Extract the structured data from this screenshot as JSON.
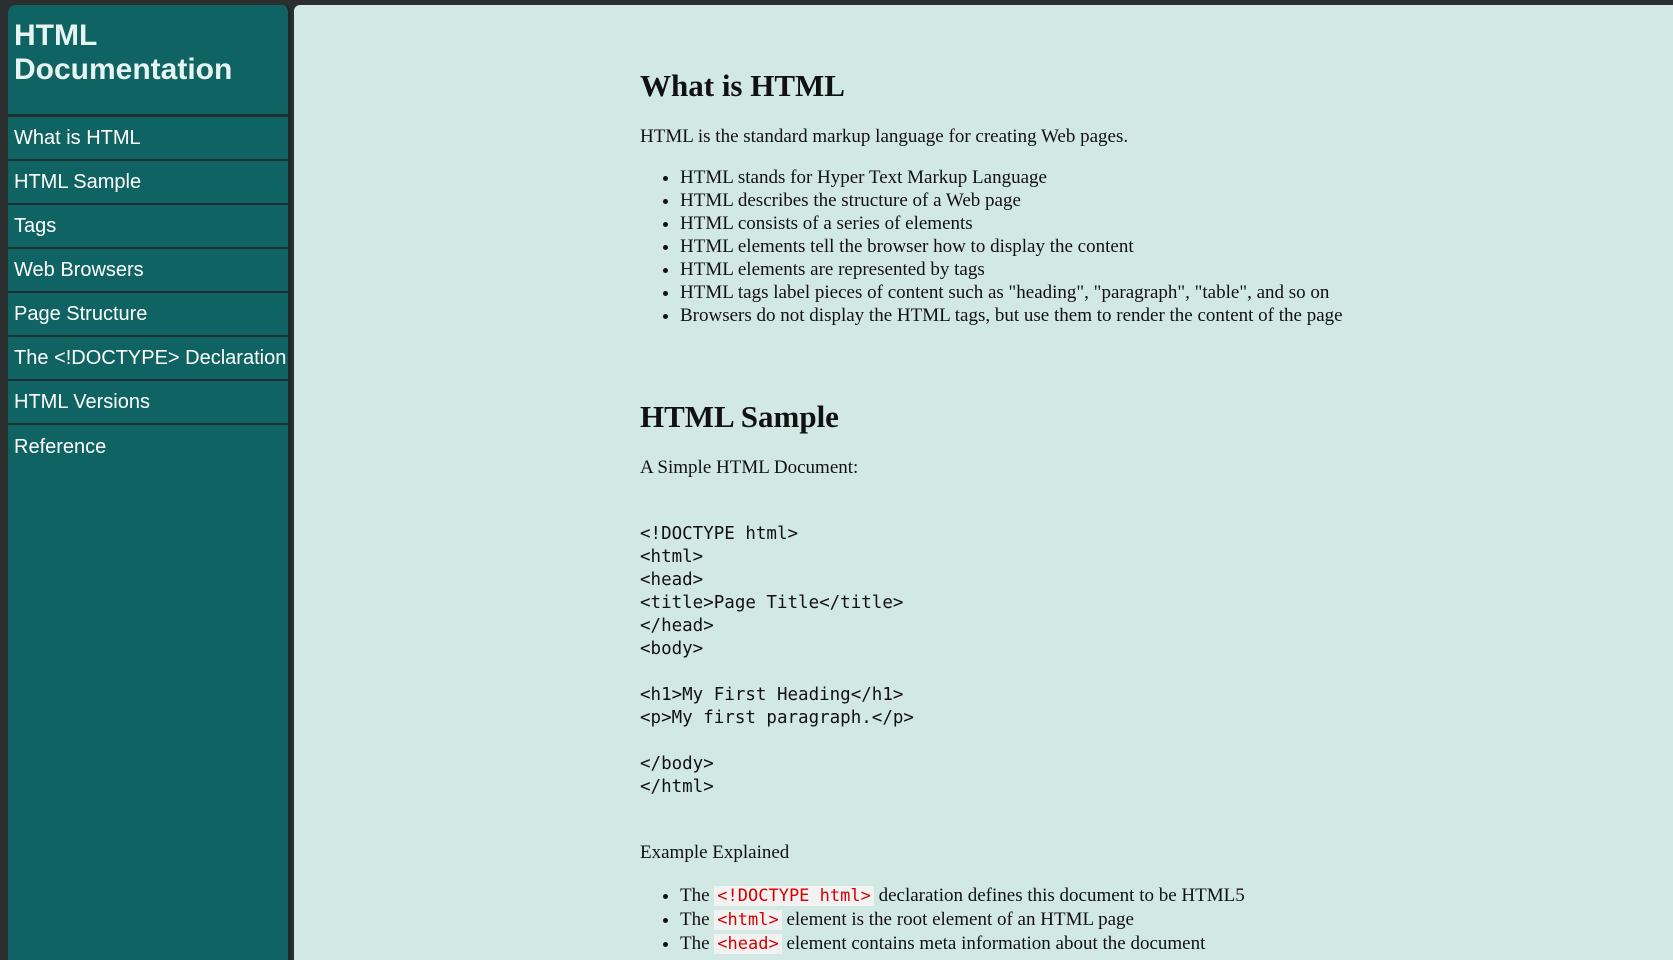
{
  "sidebar": {
    "title_line1": "HTML",
    "title_line2": "Documentation",
    "items": [
      {
        "label": "What is HTML"
      },
      {
        "label": "HTML Sample"
      },
      {
        "label": "Tags"
      },
      {
        "label": "Web Browsers"
      },
      {
        "label": "Page Structure"
      },
      {
        "label": "The <!DOCTYPE> Declaration"
      },
      {
        "label": "HTML Versions"
      },
      {
        "label": "Reference"
      }
    ]
  },
  "sections": {
    "what_is_html": {
      "heading": "What is HTML",
      "intro": "HTML is the standard markup language for creating Web pages.",
      "bullets": [
        "HTML stands for Hyper Text Markup Language",
        "HTML describes the structure of a Web page",
        "HTML consists of a series of elements",
        "HTML elements tell the browser how to display the content",
        "HTML elements are represented by tags",
        "HTML tags label pieces of content such as \"heading\", \"paragraph\", \"table\", and so on",
        "Browsers do not display the HTML tags, but use them to render the content of the page"
      ]
    },
    "html_sample": {
      "heading": "HTML Sample",
      "intro": "A Simple HTML Document:",
      "code": "<!DOCTYPE html>\n<html>\n<head>\n<title>Page Title</title>\n</head>\n<body>\n\n<h1>My First Heading</h1>\n<p>My first paragraph.</p>\n\n</body>\n</html>",
      "explained_label": "Example Explained",
      "explained": [
        {
          "prefix": "The",
          "tag": "<!DOCTYPE html>",
          "text": "declaration defines this document to be HTML5"
        },
        {
          "prefix": "The",
          "tag": "<html>",
          "text": "element is the root element of an HTML page"
        },
        {
          "prefix": "The",
          "tag": "<head>",
          "text": "element contains meta information about the document"
        }
      ]
    }
  },
  "colors": {
    "sidebar_bg": "#106363",
    "main_bg": "#d2e8e3",
    "code_tag": "#d60000"
  }
}
